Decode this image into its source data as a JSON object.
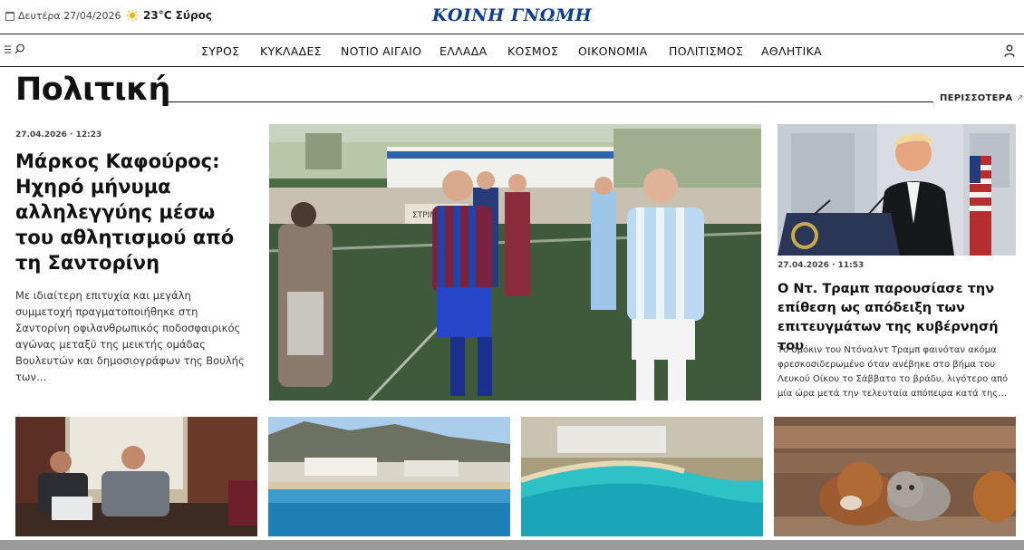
{
  "header": {
    "date": "Δευτέρα 27/04/2026",
    "weather": "23°C Σύρος",
    "logo": "ΚΟΙΝΗ ΓΝΩΜΗ"
  },
  "nav": {
    "items": [
      "ΣΥΡΟΣ",
      "ΚΥΚΛΑΔΕΣ",
      "ΝΟΤΙΟ ΑΙΓΑΙΟ",
      "ΕΛΛΑΔΑ",
      "ΚΟΣΜΟΣ",
      "ΟΙΚΟΝΟΜΙΑ",
      "ΠΟΛΙΤΙΣΜΟΣ",
      "ΑΘΛΗΤΙΚΑ"
    ]
  },
  "section": {
    "title": "Πολιτική",
    "more": "ΠΕΡΙΣΣΟΤΕΡΑ",
    "more_arrow": "↗"
  },
  "left_article": {
    "meta": "27.04.2026 · 12:23",
    "title": "Μάρκος Καφούρος: Ηχηρό μήνυμα αλληλεγγύης μέσω του αθλητισμού από τη Σαντορίνη",
    "excerpt": "Με ιδιαίτερη επιτυχία και μεγάλη συμμετοχή πραγματοποιήθηκε στη Σαντορίνη οφιλανθρωπικός ποδοσφαιρικός αγώνας μεταξύ της μεικτής ομάδας Βουλευτών και δημοσιογράφων της Βουλής των…"
  },
  "hero": {
    "banner_text": "ΣΤΡΙΝΤΖ"
  },
  "right_article": {
    "meta": "27.04.2026 · 11:53",
    "title": "Ο Ντ. Τραμπ παρουσίασε την επίθεση ως απόδειξη των επιτευγμάτων της κυβέρνησή του",
    "excerpt": "Το σμόκιν του Ντόναλντ Τραμπ φαινόταν ακόμα φρεσκοσιδερωμένο όταν ανέβηκε στο βήμα του Λευκού Οίκου το Σάββατο το βράδυ, λιγότερο από μία ώρα μετά την τελευταία απόπειρα κατά της…"
  },
  "icons": {
    "calendar": "calendar-icon",
    "weather": "sun-icon",
    "menu": "menu-icon",
    "search": "search-icon",
    "user": "user-icon"
  },
  "colors": {
    "logo": "#0b3d91",
    "weather_sun": "#f2b500"
  }
}
